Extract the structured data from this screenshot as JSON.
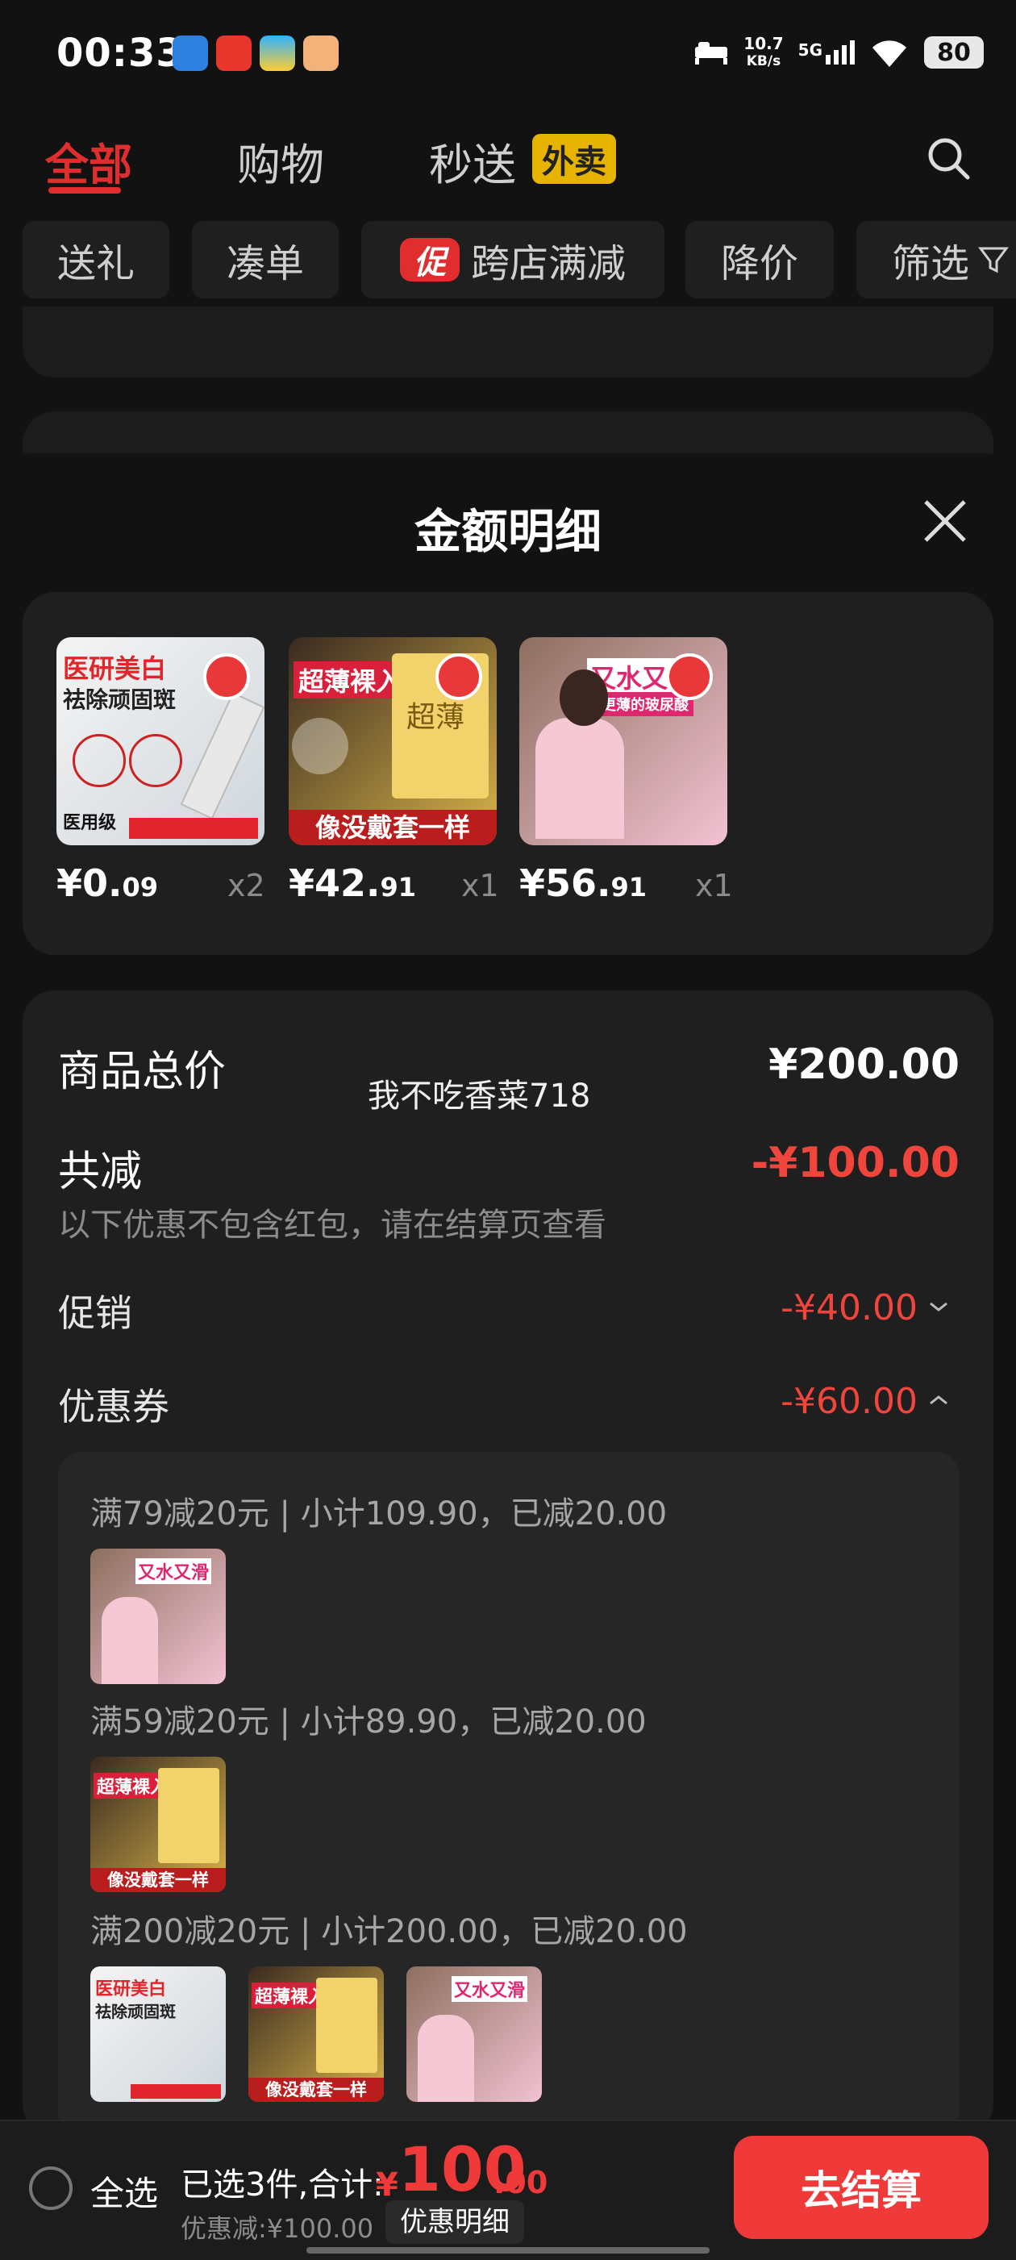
{
  "status_bar": {
    "time": "00:33",
    "net_speed": "10.7",
    "net_unit": "KB/s",
    "signal": "5G",
    "battery": "80"
  },
  "top_tabs": [
    {
      "label": "全部",
      "active": true
    },
    {
      "label": "购物",
      "active": false
    },
    {
      "label": "秒送",
      "active": false
    }
  ],
  "waimai_badge": "外卖",
  "filters": {
    "gift": "送礼",
    "bundle": "凑单",
    "promo_tag": "促",
    "cross_store": "跨店满减",
    "price_drop": "降价",
    "filter": "筛选"
  },
  "sheet": {
    "title": "金额明细",
    "items": [
      {
        "price_main": "¥0.",
        "price_dec": "09",
        "qty": "x2",
        "img_text_1": "医研美白",
        "img_text_2": "祛除顽固斑",
        "img_text_3": "医用级"
      },
      {
        "price_main": "¥42.",
        "price_dec": "91",
        "qty": "x1",
        "img_text_1": "超薄裸入",
        "img_text_2": "超薄",
        "img_text_3": "像没戴套一样"
      },
      {
        "price_main": "¥56.",
        "price_dec": "91",
        "qty": "x1",
        "img_text_1": "又水又滑",
        "img_text_2": "更薄的玻尿酸"
      }
    ],
    "total_label": "商品总价",
    "total_value": "¥200.00",
    "watermark": "我不吃香菜718",
    "reduce_label": "共减",
    "reduce_value": "-¥100.00",
    "reduce_note": "以下优惠不包含红包，请在结算页查看",
    "promo_label": "促销",
    "promo_value": "-¥40.00",
    "coupon_label": "优惠券",
    "coupon_value": "-¥60.00",
    "coupon_groups": [
      "满79减20元 | 小计109.90，已减20.00",
      "满59减20元 | 小计89.90，已减20.00",
      "满200减20元 | 小计200.00，已减20.00"
    ]
  },
  "bottom": {
    "select_all": "全选",
    "summary": "已选3件,合计:",
    "currency": "¥",
    "total_int": "100",
    "total_dec": ".00",
    "discount": "优惠减:¥100.00",
    "detail_link": "优惠明细",
    "checkout": "去结算"
  },
  "colors": {
    "accent": "#f03a3a",
    "waimai": "#e6b400",
    "background": "#121212"
  }
}
